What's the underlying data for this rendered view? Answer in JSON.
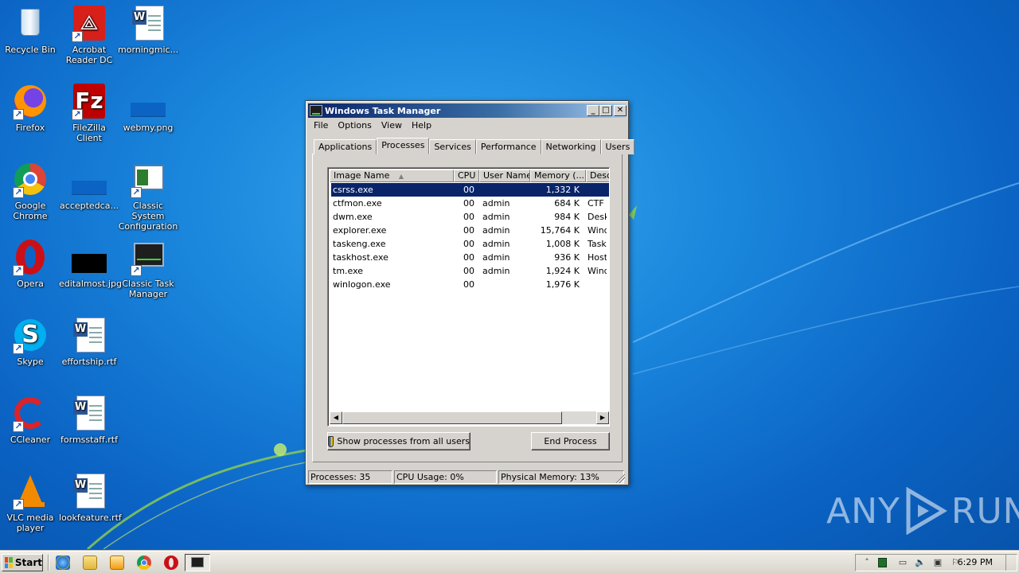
{
  "desktop": {
    "icons": [
      {
        "label": "Recycle Bin",
        "icon": "recycle-bin-icon"
      },
      {
        "label": "Acrobat Reader DC",
        "icon": "acrobat-icon"
      },
      {
        "label": "morningmic...",
        "icon": "word-doc-icon"
      },
      {
        "label": "Firefox",
        "icon": "firefox-icon"
      },
      {
        "label": "FileZilla Client",
        "icon": "filezilla-icon"
      },
      {
        "label": "webmy.png",
        "icon": "image-file-icon"
      },
      {
        "label": "Google Chrome",
        "icon": "chrome-icon"
      },
      {
        "label": "acceptedca...",
        "icon": "image-file-icon"
      },
      {
        "label": "Classic System Configuration",
        "icon": "system-config-icon"
      },
      {
        "label": "Opera",
        "icon": "opera-icon"
      },
      {
        "label": "editalmost.jpg",
        "icon": "image-file-icon"
      },
      {
        "label": "Classic Task Manager",
        "icon": "task-manager-icon"
      },
      {
        "label": "Skype",
        "icon": "skype-icon"
      },
      {
        "label": "effortship.rtf",
        "icon": "word-doc-icon"
      },
      {
        "label": "CCleaner",
        "icon": "ccleaner-icon"
      },
      {
        "label": "formsstaff.rtf",
        "icon": "word-doc-icon"
      },
      {
        "label": "VLC media player",
        "icon": "vlc-icon"
      },
      {
        "label": "lookfeature.rtf",
        "icon": "word-doc-icon"
      }
    ]
  },
  "task_manager": {
    "title": "Windows Task Manager",
    "menu": [
      "File",
      "Options",
      "View",
      "Help"
    ],
    "tabs": [
      "Applications",
      "Processes",
      "Services",
      "Performance",
      "Networking",
      "Users"
    ],
    "active_tab": "Processes",
    "columns": [
      "Image Name",
      "CPU",
      "User Name",
      "Memory (...",
      "Desc"
    ],
    "processes": [
      {
        "name": "csrss.exe",
        "cpu": "00",
        "user": "",
        "memory": "1,332 K",
        "desc": ""
      },
      {
        "name": "ctfmon.exe",
        "cpu": "00",
        "user": "admin",
        "memory": "684 K",
        "desc": "CTF I"
      },
      {
        "name": "dwm.exe",
        "cpu": "00",
        "user": "admin",
        "memory": "984 K",
        "desc": "Desk"
      },
      {
        "name": "explorer.exe",
        "cpu": "00",
        "user": "admin",
        "memory": "15,764 K",
        "desc": "Wind"
      },
      {
        "name": "taskeng.exe",
        "cpu": "00",
        "user": "admin",
        "memory": "1,008 K",
        "desc": "Task"
      },
      {
        "name": "taskhost.exe",
        "cpu": "00",
        "user": "admin",
        "memory": "936 K",
        "desc": "Host"
      },
      {
        "name": "tm.exe",
        "cpu": "00",
        "user": "admin",
        "memory": "1,924 K",
        "desc": "Wind"
      },
      {
        "name": "winlogon.exe",
        "cpu": "00",
        "user": "",
        "memory": "1,976 K",
        "desc": ""
      }
    ],
    "selected_row": 0,
    "show_all_label": "Show processes from all users",
    "end_process_label": "End Process",
    "status": {
      "processes": "Processes: 35",
      "cpu": "CPU Usage: 0%",
      "memory": "Physical Memory: 13%"
    }
  },
  "watermark": {
    "left": "ANY",
    "right": "RUN"
  },
  "taskbar": {
    "start_label": "Start",
    "clock": "6:29 PM",
    "quick_launch": [
      "ie-icon",
      "folder-icon",
      "media-player-icon",
      "chrome-icon",
      "opera-icon"
    ]
  },
  "colors": {
    "desktop_bg": "#1a86dc",
    "title_bar": "#0a246a",
    "selection": "#0a246a",
    "window_face": "#d6d3ce"
  }
}
